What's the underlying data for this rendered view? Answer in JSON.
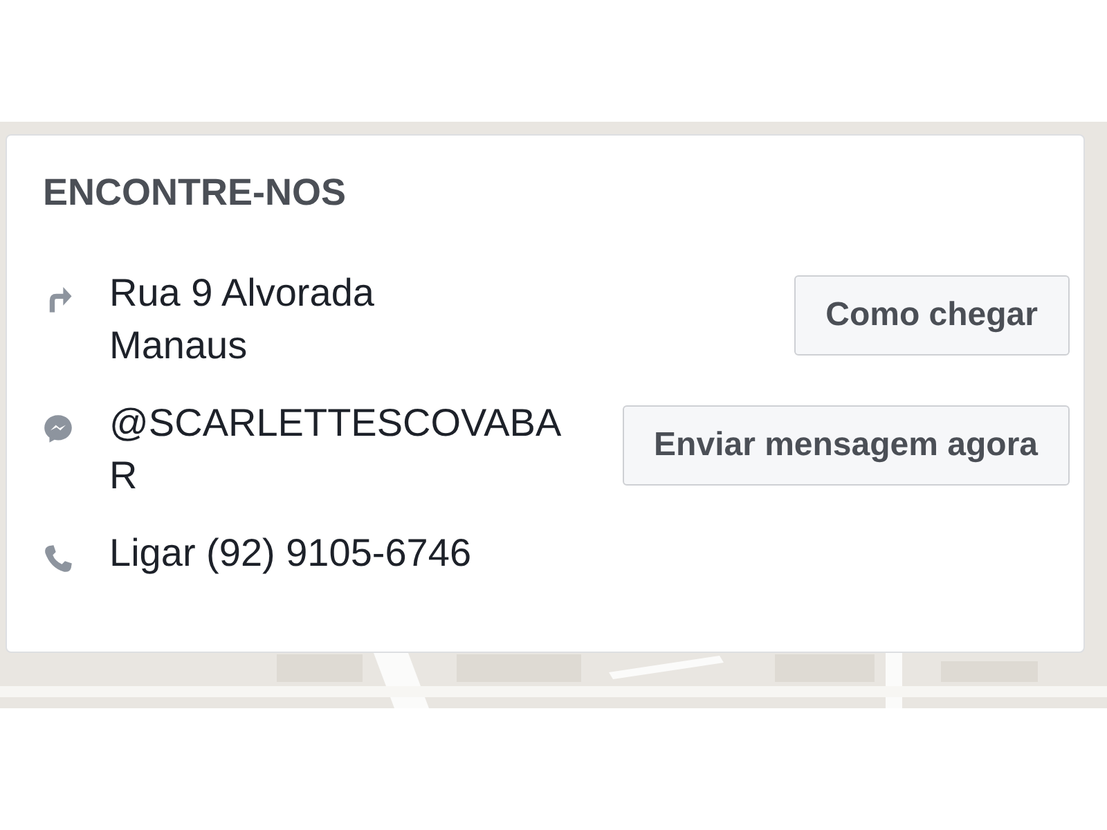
{
  "card": {
    "title": "ENCONTRE-NOS",
    "rows": [
      {
        "kind": "address",
        "lines": [
          "Rua 9 Alvorada",
          "Manaus"
        ],
        "button": "Como chegar"
      },
      {
        "kind": "messenger",
        "lines": [
          "@SCARLETTESCOVABAR"
        ],
        "button": "Enviar mensagem agora"
      },
      {
        "kind": "phone",
        "lines": [
          "Ligar (92) 9105-6746"
        ]
      }
    ]
  }
}
